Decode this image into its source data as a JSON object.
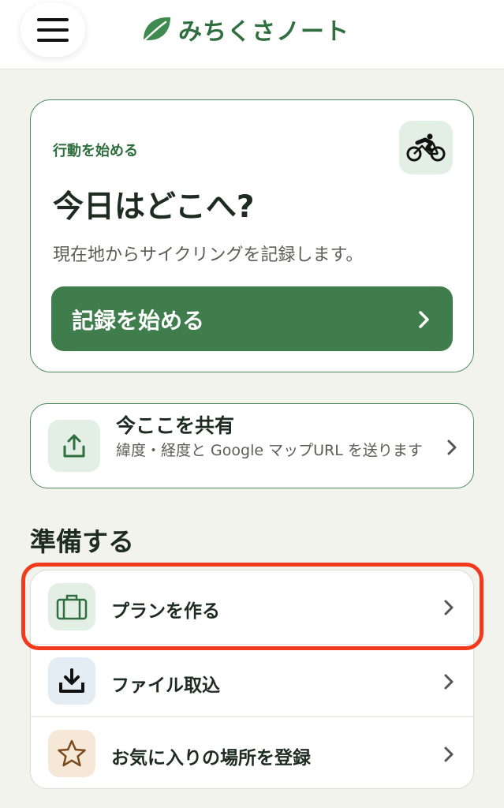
{
  "header": {
    "menu_icon": "hamburger-menu-icon",
    "logo_icon": "leaf-icon",
    "app_name": "みちくさノート",
    "brand_color": "#2f6e3e"
  },
  "hero": {
    "label": "行動を始める",
    "icon": "cyclist-icon",
    "title": "今日はどこへ?",
    "description": "現在地からサイクリングを記録します。",
    "button_label": "記録を始める",
    "button_color": "#3f7d4c"
  },
  "share": {
    "icon": "share-upload-icon",
    "title": "今ここを共有",
    "description": "緯度・経度と Google マップURL を送ります"
  },
  "prepare": {
    "section_title": "準備する",
    "items": [
      {
        "label": "プランを作る",
        "icon": "suitcase-icon",
        "highlighted": true
      },
      {
        "label": "ファイル取込",
        "icon": "download-icon"
      },
      {
        "label": "お気に入りの場所を登録",
        "icon": "star-icon"
      }
    ]
  },
  "highlight_color": "#f23a1f"
}
